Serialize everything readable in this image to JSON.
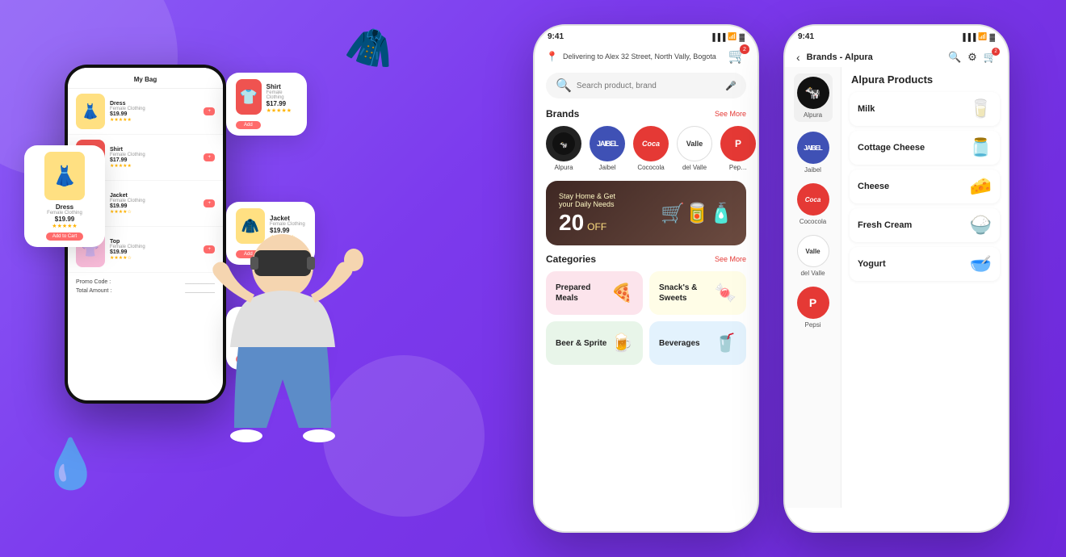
{
  "background_color": "#7B4FCC",
  "left_phone": {
    "title": "My Bag",
    "items": [
      {
        "name": "Dress",
        "category": "Female Clothing",
        "price": "$19.99",
        "stars": "★★★★★",
        "emoji": "👗",
        "bg": "yellow"
      },
      {
        "name": "Shirt",
        "category": "Female Clothing",
        "price": "$17.99",
        "stars": "★★★★★",
        "emoji": "👕",
        "bg": "red"
      },
      {
        "name": "Jacket",
        "category": "Female Clothing",
        "price": "$19.99",
        "stars": "★★★★☆",
        "emoji": "🧥",
        "bg": "yellow"
      },
      {
        "name": "Top",
        "category": "Female Clothing",
        "price": "$19.99",
        "stars": "★★★★☆",
        "emoji": "👚",
        "bg": "pink"
      }
    ],
    "promo_label": "Promo Code :",
    "total_label": "Total Amount :"
  },
  "floating_dress": {
    "name": "Dress",
    "category": "Female Clothing",
    "price": "$19.99",
    "stars": "★★★★★",
    "emoji": "👗"
  },
  "middle_phone": {
    "status_time": "9:41",
    "delivery_label": "Delivering to Alex",
    "delivery_address": "32 Street, North Vally, Bogota",
    "cart_count": "2",
    "search_placeholder": "Search product, brand",
    "brands_title": "Brands",
    "brands_see_more": "See More",
    "brands": [
      {
        "name": "Alpura",
        "bg": "alpura",
        "emoji": "🐄"
      },
      {
        "name": "Jaibel",
        "bg": "jaibel",
        "text": "JAIBEL"
      },
      {
        "name": "Cococola",
        "bg": "cococola",
        "text": "Coca"
      },
      {
        "name": "del Valle",
        "bg": "delvalle",
        "text": "Valle"
      },
      {
        "name": "Pep…",
        "bg": "pepsi",
        "text": "P"
      }
    ],
    "promo": {
      "line1": "Stay Home & Get",
      "line2": "your Daily Needs",
      "discount": "20",
      "off": "OFF"
    },
    "categories_title": "Categories",
    "categories_see_more": "See More",
    "categories": [
      {
        "label": "Prepared Meals",
        "emoji": "🍕",
        "bg": "pink-bg"
      },
      {
        "label": "Snack's & Sweets",
        "emoji": "🍬",
        "bg": "yellow-bg"
      },
      {
        "label": "Beer & Sprite",
        "emoji": "🍺",
        "bg": "green-bg"
      },
      {
        "label": "Beverages",
        "emoji": "🥤",
        "bg": "blue-bg"
      }
    ]
  },
  "right_phone": {
    "status_time": "9:41",
    "back_label": "<",
    "title": "Brands - Alpura",
    "products_title": "Alpura Products",
    "brands": [
      {
        "name": "Alpura",
        "emoji": "🐄",
        "bg": "alpura"
      },
      {
        "name": "Jaibel",
        "text": "J",
        "bg": "jaibel"
      },
      {
        "name": "Cococola",
        "text": "C",
        "bg": "cococola"
      },
      {
        "name": "del Valle",
        "text": "V",
        "bg": "delvalle"
      },
      {
        "name": "Pepsi",
        "text": "P",
        "bg": "pepsi"
      }
    ],
    "products": [
      {
        "name": "Milk",
        "emoji": "🥛"
      },
      {
        "name": "Cottage Cheese",
        "emoji": "🧀"
      },
      {
        "name": "Cheese",
        "emoji": "🧀"
      },
      {
        "name": "Fresh Cream",
        "emoji": "🫙"
      },
      {
        "name": "Yogurt",
        "emoji": "🥣"
      }
    ]
  }
}
